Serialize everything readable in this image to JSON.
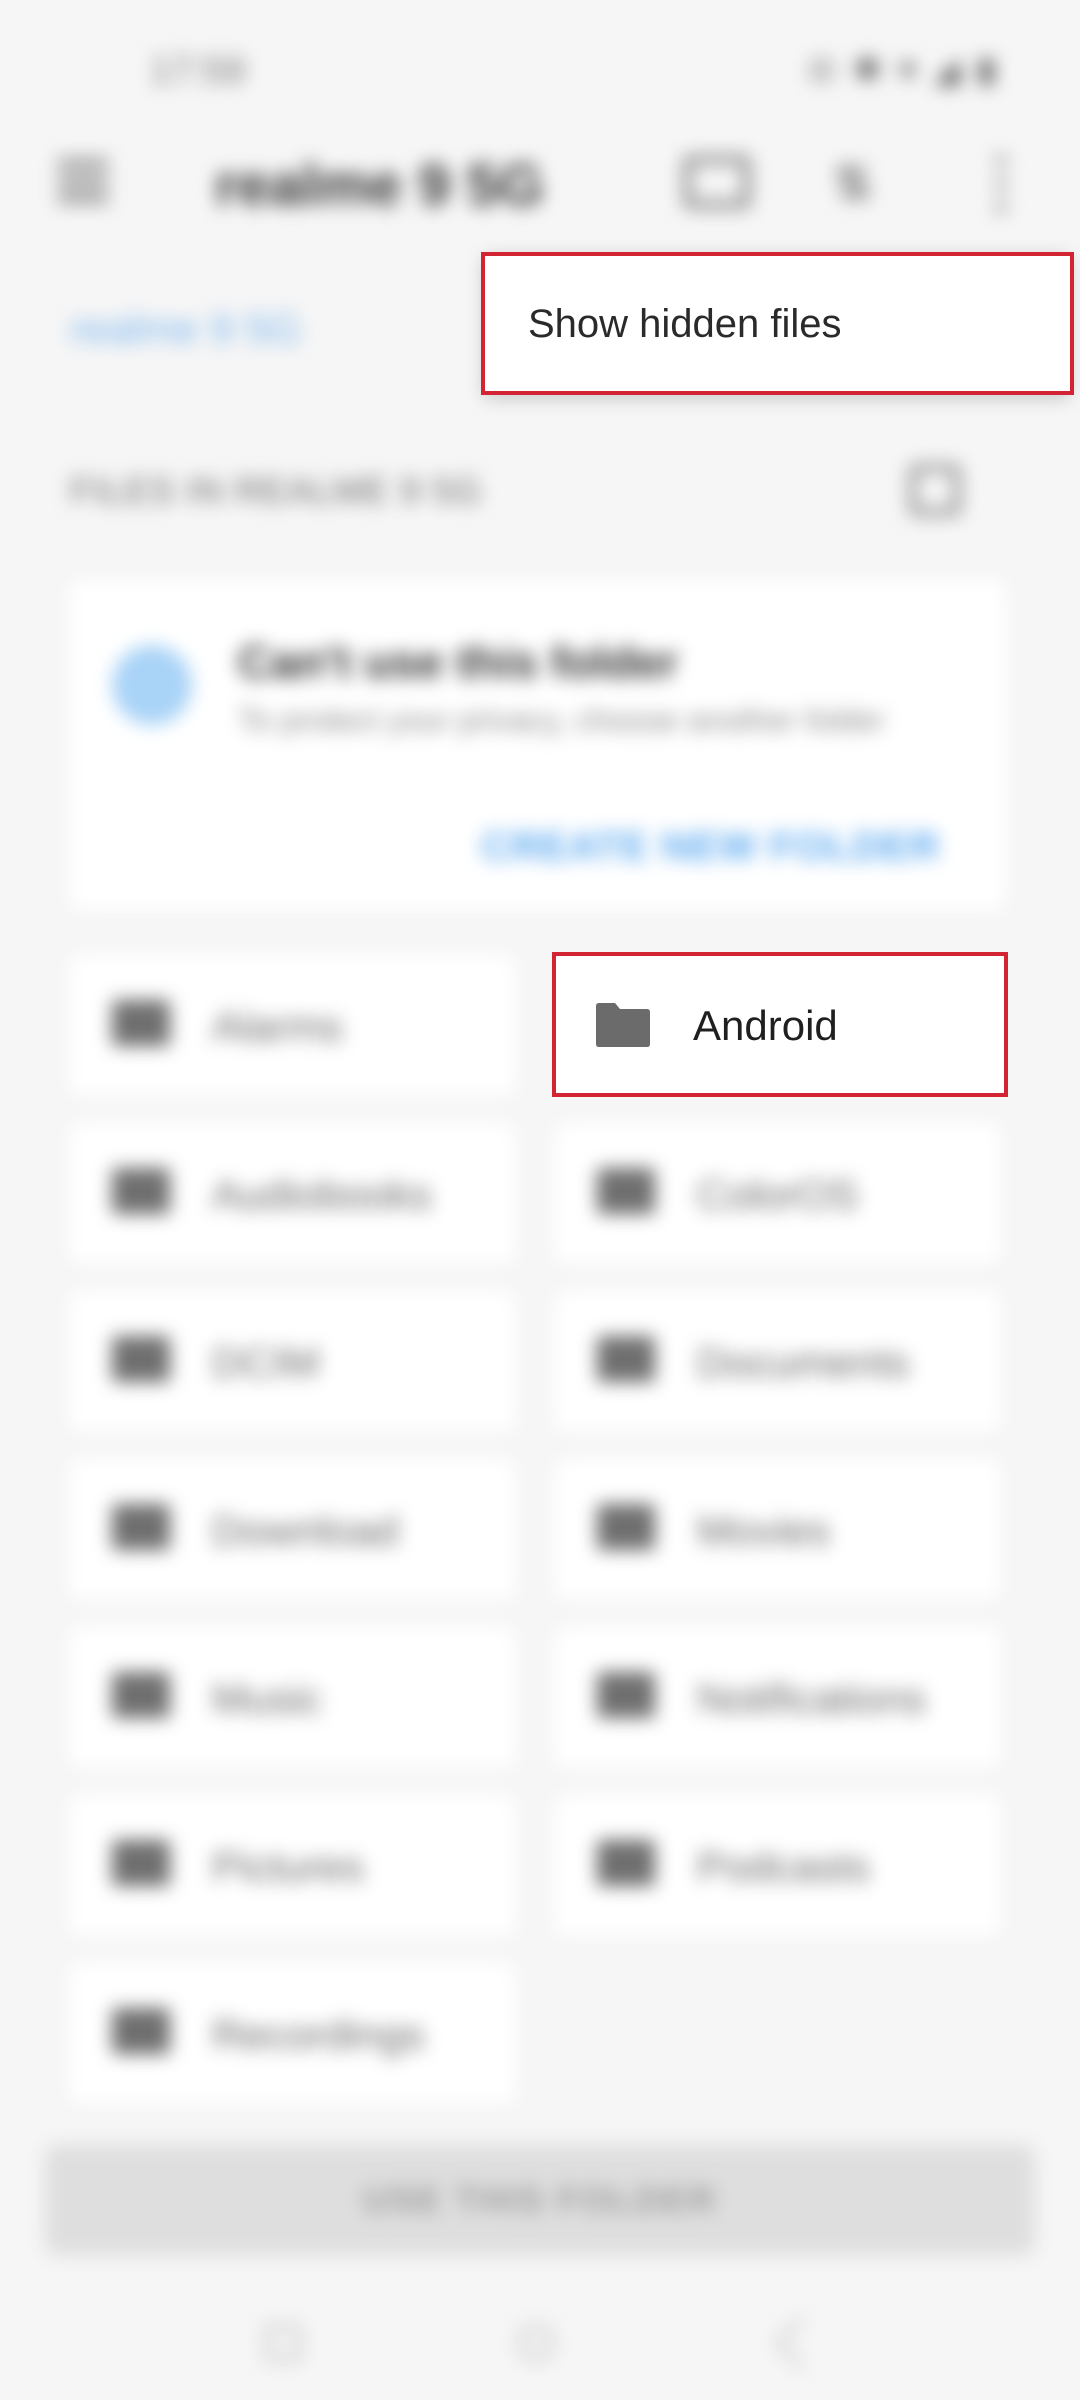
{
  "status_bar": {
    "time": "17:59",
    "icons": "⊙ ✱ ▾ ◢ ▮"
  },
  "app_bar": {
    "title": "realme 9 5G",
    "menu_icon": "hamburger-icon",
    "new_folder_icon": "new-folder-icon",
    "sort_icon": "sort-icon",
    "overflow_icon": "more-vert-icon"
  },
  "breadcrumb": "realme 9 5G",
  "files_header": "FILES IN REALME 9 5G",
  "warning_card": {
    "title": "Can't use this folder",
    "body": "To protect your privacy, choose another folder",
    "action": "CREATE NEW FOLDER"
  },
  "folders": [
    "Alarms",
    "Android",
    "Audiobooks",
    "ColorOS",
    "DCIM",
    "Documents",
    "Download",
    "Movies",
    "Music",
    "Notifications",
    "Pictures",
    "Podcasts",
    "Recordings"
  ],
  "popup_menu": {
    "item": "Show hidden files"
  },
  "bottom_button": "USE THIS FOLDER",
  "colors": {
    "highlight": "#d32433",
    "accent": "#5aa8f0"
  }
}
